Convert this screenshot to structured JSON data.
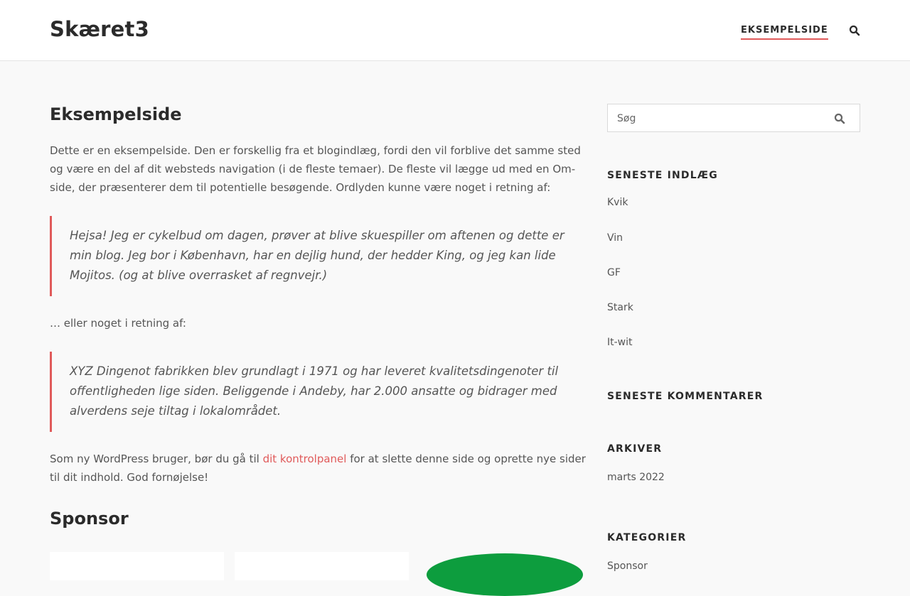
{
  "header": {
    "site_title": "Skæret3",
    "nav_items": [
      "EKSEMPELSIDE"
    ]
  },
  "main": {
    "page_title": "Eksempelside",
    "intro": "Dette er en eksempelside. Den er forskellig fra et blogindlæg, fordi den vil forblive det samme sted og være en del af dit websteds navigation (i de fleste temaer). De fleste vil lægge ud med en Om-side, der præsenterer dem til potentielle besøgende. Ordlyden kunne være noget i retning af:",
    "quote1": "Hejsa! Jeg er cykelbud om dagen, prøver at blive skuespiller om aftenen og dette er min blog. Jeg bor i København, har en dejlig hund, der hedder King, og jeg kan lide Mojitos. (og at blive overrasket af regnvejr.)",
    "middle": "… eller noget i retning af:",
    "quote2": "XYZ Dingenot fabrikken blev grundlagt i 1971 og har leveret kvalitetsdingenoter til offentligheden lige siden. Beliggende i Andeby, har 2.000 ansatte og bidrager med alverdens seje tiltag i lokalområdet.",
    "closing_before": "Som ny WordPress bruger, bør du gå til ",
    "closing_link": "dit kontrolpanel",
    "closing_after": " for at slette denne side og oprette nye sider til dit indhold. God fornøjelse!",
    "sponsor_title": "Sponsor"
  },
  "sidebar": {
    "search_placeholder": "Søg",
    "recent_posts_title": "SENESTE INDLÆG",
    "recent_posts": [
      "Kvik",
      "Vin",
      "GF",
      "Stark",
      "It-wit"
    ],
    "recent_comments_title": "SENESTE KOMMENTARER",
    "archives_title": "ARKIVER",
    "archives": [
      "marts 2022"
    ],
    "categories_title": "KATEGORIER",
    "categories": [
      "Sponsor"
    ]
  },
  "colors": {
    "accent": "#e05a5a",
    "heading": "#2b2b2b",
    "text": "#555555",
    "sponsor_green": "#0d9d3e"
  },
  "icons": {
    "nav_search": "search-icon",
    "sidebar_search": "search-icon"
  }
}
